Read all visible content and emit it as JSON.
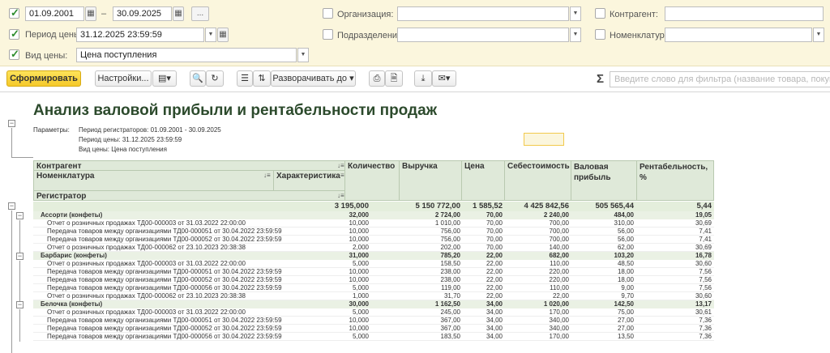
{
  "filters": {
    "date_from": "01.09.2001",
    "date_dash": "–",
    "date_to": "30.09.2025",
    "date_more": "...",
    "price_period_label": "Период цены:",
    "price_period_value": "31.12.2025 23:59:59",
    "price_type_label": "Вид цены:",
    "price_type_value": "Цена поступления",
    "org_label": "Организация:",
    "dept_label": "Подразделение:",
    "counterparty_label": "Контрагент:",
    "nomenclature_label": "Номенклатура:"
  },
  "toolbar": {
    "generate": "Сформировать",
    "settings": "Настройки...",
    "expand": "Разворачивать до",
    "filter_placeholder": "Введите слово для фильтра (название товара, покупателя и п"
  },
  "report": {
    "title": "Анализ валовой прибыли и рентабельности продаж",
    "params_label": "Параметры:",
    "params": [
      "Период регистраторов: 01.09.2001 - 30.09.2025",
      "Период цены: 31.12.2025 23:59:59",
      "Вид цены: Цена поступления"
    ],
    "headers": {
      "counterparty": "Контрагент",
      "nomenclature": "Номенклатура",
      "characteristic": "Характеристика",
      "registrar": "Регистратор",
      "quantity": "Количество",
      "revenue": "Выручка",
      "price": "Цена",
      "cost": "Себестоимость",
      "gross_profit": "Валовая прибыль",
      "profitability": "Рентабельность, %"
    },
    "total": {
      "quantity": "3 195,000",
      "revenue": "5 150 772,00",
      "price": "1 585,52",
      "cost": "4 425 842,56",
      "gross": "505 565,44",
      "profit": "5,44"
    },
    "groups": [
      {
        "name": "Ассорти (конфеты)",
        "quantity": "32,000",
        "revenue": "2 724,00",
        "price": "70,00",
        "cost": "2 240,00",
        "gross": "484,00",
        "profit": "19,05",
        "rows": [
          {
            "doc": "Отчет о розничных продажах ТД00-000003 от 31.03.2022 22:00:00",
            "quantity": "10,000",
            "revenue": "1 010,00",
            "price": "70,00",
            "cost": "700,00",
            "gross": "310,00",
            "profit": "30,69"
          },
          {
            "doc": "Передача товаров между организациями ТД00-000051 от 30.04.2022 23:59:59",
            "quantity": "10,000",
            "revenue": "756,00",
            "price": "70,00",
            "cost": "700,00",
            "gross": "56,00",
            "profit": "7,41"
          },
          {
            "doc": "Передача товаров между организациями ТД00-000052 от 30.04.2022 23:59:59",
            "quantity": "10,000",
            "revenue": "756,00",
            "price": "70,00",
            "cost": "700,00",
            "gross": "56,00",
            "profit": "7,41"
          },
          {
            "doc": "Отчет о розничных продажах ТД00-000062 от 23.10.2023 20:38:38",
            "quantity": "2,000",
            "revenue": "202,00",
            "price": "70,00",
            "cost": "140,00",
            "gross": "62,00",
            "profit": "30,69"
          }
        ]
      },
      {
        "name": "Барбарис (конфеты)",
        "quantity": "31,000",
        "revenue": "785,20",
        "price": "22,00",
        "cost": "682,00",
        "gross": "103,20",
        "profit": "16,78",
        "rows": [
          {
            "doc": "Отчет о розничных продажах ТД00-000003 от 31.03.2022 22:00:00",
            "quantity": "5,000",
            "revenue": "158,50",
            "price": "22,00",
            "cost": "110,00",
            "gross": "48,50",
            "profit": "30,60"
          },
          {
            "doc": "Передача товаров между организациями ТД00-000051 от 30.04.2022 23:59:59",
            "quantity": "10,000",
            "revenue": "238,00",
            "price": "22,00",
            "cost": "220,00",
            "gross": "18,00",
            "profit": "7,56"
          },
          {
            "doc": "Передача товаров между организациями ТД00-000052 от 30.04.2022 23:59:59",
            "quantity": "10,000",
            "revenue": "238,00",
            "price": "22,00",
            "cost": "220,00",
            "gross": "18,00",
            "profit": "7,56"
          },
          {
            "doc": "Передача товаров между организациями ТД00-000056 от 30.04.2022 23:59:59",
            "quantity": "5,000",
            "revenue": "119,00",
            "price": "22,00",
            "cost": "110,00",
            "gross": "9,00",
            "profit": "7,56"
          },
          {
            "doc": "Отчет о розничных продажах ТД00-000062 от 23.10.2023 20:38:38",
            "quantity": "1,000",
            "revenue": "31,70",
            "price": "22,00",
            "cost": "22,00",
            "gross": "9,70",
            "profit": "30,60"
          }
        ]
      },
      {
        "name": "Белочка (конфеты)",
        "quantity": "30,000",
        "revenue": "1 162,50",
        "price": "34,00",
        "cost": "1 020,00",
        "gross": "142,50",
        "profit": "13,17",
        "rows": [
          {
            "doc": "Отчет о розничных продажах ТД00-000003 от 31.03.2022 22:00:00",
            "quantity": "5,000",
            "revenue": "245,00",
            "price": "34,00",
            "cost": "170,00",
            "gross": "75,00",
            "profit": "30,61"
          },
          {
            "doc": "Передача товаров между организациями ТД00-000051 от 30.04.2022 23:59:59",
            "quantity": "10,000",
            "revenue": "367,00",
            "price": "34,00",
            "cost": "340,00",
            "gross": "27,00",
            "profit": "7,36"
          },
          {
            "doc": "Передача товаров между организациями ТД00-000052 от 30.04.2022 23:59:59",
            "quantity": "10,000",
            "revenue": "367,00",
            "price": "34,00",
            "cost": "340,00",
            "gross": "27,00",
            "profit": "7,36"
          },
          {
            "doc": "Передача товаров между организациями ТД00-000056 от 30.04.2022 23:59:59",
            "quantity": "5,000",
            "revenue": "183,50",
            "price": "34,00",
            "cost": "170,00",
            "gross": "13,50",
            "profit": "7,36"
          }
        ]
      }
    ]
  }
}
